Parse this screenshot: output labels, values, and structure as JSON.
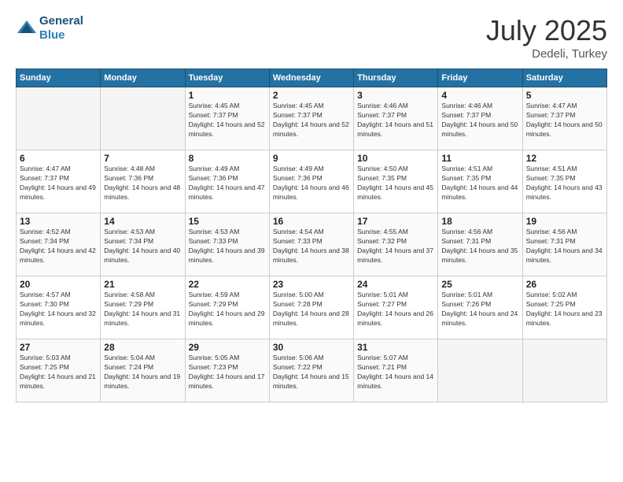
{
  "header": {
    "logo_line1": "General",
    "logo_line2": "Blue",
    "month": "July 2025",
    "location": "Dedeli, Turkey"
  },
  "weekdays": [
    "Sunday",
    "Monday",
    "Tuesday",
    "Wednesday",
    "Thursday",
    "Friday",
    "Saturday"
  ],
  "weeks": [
    [
      {
        "day": "",
        "empty": true
      },
      {
        "day": "",
        "empty": true
      },
      {
        "day": "1",
        "sunrise": "4:45 AM",
        "sunset": "7:37 PM",
        "daylight": "14 hours and 52 minutes."
      },
      {
        "day": "2",
        "sunrise": "4:45 AM",
        "sunset": "7:37 PM",
        "daylight": "14 hours and 52 minutes."
      },
      {
        "day": "3",
        "sunrise": "4:46 AM",
        "sunset": "7:37 PM",
        "daylight": "14 hours and 51 minutes."
      },
      {
        "day": "4",
        "sunrise": "4:46 AM",
        "sunset": "7:37 PM",
        "daylight": "14 hours and 50 minutes."
      },
      {
        "day": "5",
        "sunrise": "4:47 AM",
        "sunset": "7:37 PM",
        "daylight": "14 hours and 50 minutes."
      }
    ],
    [
      {
        "day": "6",
        "sunrise": "4:47 AM",
        "sunset": "7:37 PM",
        "daylight": "14 hours and 49 minutes."
      },
      {
        "day": "7",
        "sunrise": "4:48 AM",
        "sunset": "7:36 PM",
        "daylight": "14 hours and 48 minutes."
      },
      {
        "day": "8",
        "sunrise": "4:49 AM",
        "sunset": "7:36 PM",
        "daylight": "14 hours and 47 minutes."
      },
      {
        "day": "9",
        "sunrise": "4:49 AM",
        "sunset": "7:36 PM",
        "daylight": "14 hours and 46 minutes."
      },
      {
        "day": "10",
        "sunrise": "4:50 AM",
        "sunset": "7:35 PM",
        "daylight": "14 hours and 45 minutes."
      },
      {
        "day": "11",
        "sunrise": "4:51 AM",
        "sunset": "7:35 PM",
        "daylight": "14 hours and 44 minutes."
      },
      {
        "day": "12",
        "sunrise": "4:51 AM",
        "sunset": "7:35 PM",
        "daylight": "14 hours and 43 minutes."
      }
    ],
    [
      {
        "day": "13",
        "sunrise": "4:52 AM",
        "sunset": "7:34 PM",
        "daylight": "14 hours and 42 minutes."
      },
      {
        "day": "14",
        "sunrise": "4:53 AM",
        "sunset": "7:34 PM",
        "daylight": "14 hours and 40 minutes."
      },
      {
        "day": "15",
        "sunrise": "4:53 AM",
        "sunset": "7:33 PM",
        "daylight": "14 hours and 39 minutes."
      },
      {
        "day": "16",
        "sunrise": "4:54 AM",
        "sunset": "7:33 PM",
        "daylight": "14 hours and 38 minutes."
      },
      {
        "day": "17",
        "sunrise": "4:55 AM",
        "sunset": "7:32 PM",
        "daylight": "14 hours and 37 minutes."
      },
      {
        "day": "18",
        "sunrise": "4:56 AM",
        "sunset": "7:31 PM",
        "daylight": "14 hours and 35 minutes."
      },
      {
        "day": "19",
        "sunrise": "4:56 AM",
        "sunset": "7:31 PM",
        "daylight": "14 hours and 34 minutes."
      }
    ],
    [
      {
        "day": "20",
        "sunrise": "4:57 AM",
        "sunset": "7:30 PM",
        "daylight": "14 hours and 32 minutes."
      },
      {
        "day": "21",
        "sunrise": "4:58 AM",
        "sunset": "7:29 PM",
        "daylight": "14 hours and 31 minutes."
      },
      {
        "day": "22",
        "sunrise": "4:59 AM",
        "sunset": "7:29 PM",
        "daylight": "14 hours and 29 minutes."
      },
      {
        "day": "23",
        "sunrise": "5:00 AM",
        "sunset": "7:28 PM",
        "daylight": "14 hours and 28 minutes."
      },
      {
        "day": "24",
        "sunrise": "5:01 AM",
        "sunset": "7:27 PM",
        "daylight": "14 hours and 26 minutes."
      },
      {
        "day": "25",
        "sunrise": "5:01 AM",
        "sunset": "7:26 PM",
        "daylight": "14 hours and 24 minutes."
      },
      {
        "day": "26",
        "sunrise": "5:02 AM",
        "sunset": "7:25 PM",
        "daylight": "14 hours and 23 minutes."
      }
    ],
    [
      {
        "day": "27",
        "sunrise": "5:03 AM",
        "sunset": "7:25 PM",
        "daylight": "14 hours and 21 minutes."
      },
      {
        "day": "28",
        "sunrise": "5:04 AM",
        "sunset": "7:24 PM",
        "daylight": "14 hours and 19 minutes."
      },
      {
        "day": "29",
        "sunrise": "5:05 AM",
        "sunset": "7:23 PM",
        "daylight": "14 hours and 17 minutes."
      },
      {
        "day": "30",
        "sunrise": "5:06 AM",
        "sunset": "7:22 PM",
        "daylight": "14 hours and 15 minutes."
      },
      {
        "day": "31",
        "sunrise": "5:07 AM",
        "sunset": "7:21 PM",
        "daylight": "14 hours and 14 minutes."
      },
      {
        "day": "",
        "empty": true
      },
      {
        "day": "",
        "empty": true
      }
    ]
  ],
  "labels": {
    "sunrise": "Sunrise: ",
    "sunset": "Sunset: ",
    "daylight": "Daylight: "
  }
}
